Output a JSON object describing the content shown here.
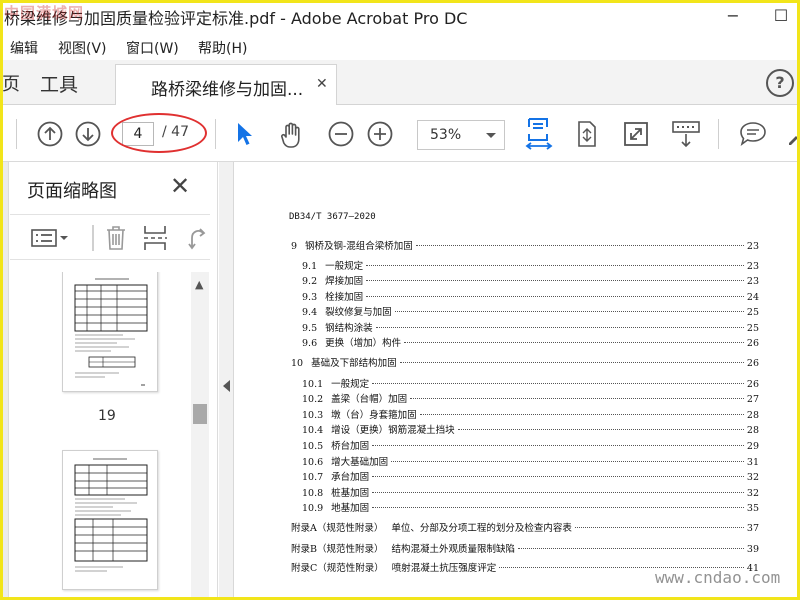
{
  "window": {
    "title": "桥梁维修与加固质量检验评定标准.pdf - Adobe Acrobat Pro DC",
    "watermark": "中国满城网",
    "minimize": "−",
    "maximize": "☐"
  },
  "menu": [
    "编辑",
    "视图(V)",
    "窗口(W)",
    "帮助(H)"
  ],
  "tabs": {
    "edge": "页",
    "tools": "工具",
    "doc_label": "路桥梁维修与加固...",
    "close": "✕",
    "help": "?"
  },
  "toolbar": {
    "current_page": "4",
    "total_pages": "/ 47",
    "zoom": "53%",
    "icons": [
      "arrow-up-icon",
      "arrow-down-icon",
      "select-cursor-icon",
      "hand-icon",
      "zoom-out-icon",
      "zoom-in-icon",
      "fit-page-icon",
      "rotate-page-icon",
      "fullscreen-icon",
      "scroll-mode-icon",
      "comment-icon"
    ],
    "accent": "#1473e6",
    "annotation_color": "#e03030"
  },
  "sidebar": {
    "title": "页面缩略图",
    "close": "✕",
    "thumbnails": [
      {
        "label": "19"
      },
      {
        "label": ""
      }
    ]
  },
  "document": {
    "header": "DB34/T 3677—2020",
    "toc": [
      {
        "num": "9",
        "title": "钢桥及钢-混组合梁桥加固",
        "page": "23",
        "level": 1
      },
      {
        "num": "9.1",
        "title": "一般规定",
        "page": "23",
        "level": 2
      },
      {
        "num": "9.2",
        "title": "焊接加固",
        "page": "23",
        "level": 2
      },
      {
        "num": "9.3",
        "title": "栓接加固",
        "page": "24",
        "level": 2
      },
      {
        "num": "9.4",
        "title": "裂纹修复与加固",
        "page": "25",
        "level": 2
      },
      {
        "num": "9.5",
        "title": "钢结构涂装",
        "page": "25",
        "level": 2
      },
      {
        "num": "9.6",
        "title": "更换（增加）构件",
        "page": "26",
        "level": 2
      },
      {
        "num": "10",
        "title": "基础及下部结构加固",
        "page": "26",
        "level": 1
      },
      {
        "num": "10.1",
        "title": "一般规定",
        "page": "26",
        "level": 2
      },
      {
        "num": "10.2",
        "title": "盖梁（台帽）加固",
        "page": "27",
        "level": 2
      },
      {
        "num": "10.3",
        "title": "墩（台）身套箍加固",
        "page": "28",
        "level": 2
      },
      {
        "num": "10.4",
        "title": "增设（更换）钢筋混凝土挡块",
        "page": "28",
        "level": 2
      },
      {
        "num": "10.5",
        "title": "桥台加固",
        "page": "29",
        "level": 2
      },
      {
        "num": "10.6",
        "title": "增大基础加固",
        "page": "31",
        "level": 2
      },
      {
        "num": "10.7",
        "title": "承台加固",
        "page": "32",
        "level": 2
      },
      {
        "num": "10.8",
        "title": "桩基加固",
        "page": "32",
        "level": 2
      },
      {
        "num": "10.9",
        "title": "地基加固",
        "page": "35",
        "level": 2
      },
      {
        "num": "附录A（规范性附录）",
        "title": "单位、分部及分项工程的划分及检查内容表",
        "page": "37",
        "level": 1
      },
      {
        "num": "附录B（规范性附录）",
        "title": "结构混凝土外观质量限制缺陷",
        "page": "39",
        "level": 1
      },
      {
        "num": "附录C（规范性附录）",
        "title": "喷射混凝土抗压强度评定",
        "page": "41",
        "level": 1
      }
    ],
    "site_watermark": "www.cndao.com"
  }
}
